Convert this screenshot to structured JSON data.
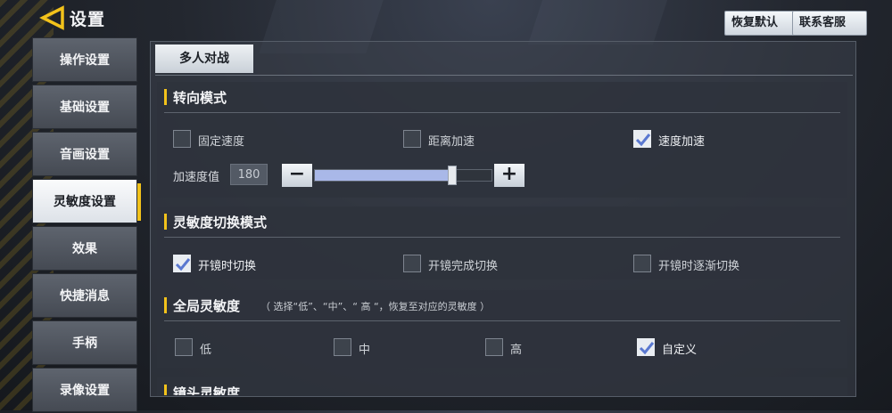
{
  "header": {
    "title": "设置",
    "restore_default": "恢复默认",
    "contact_support": "联系客服"
  },
  "sidebar": {
    "items": [
      {
        "label": "操作设置"
      },
      {
        "label": "基础设置"
      },
      {
        "label": "音画设置"
      },
      {
        "label": "灵敏度设置",
        "active": true
      },
      {
        "label": "效果"
      },
      {
        "label": "快捷消息"
      },
      {
        "label": "手柄"
      },
      {
        "label": "录像设置"
      }
    ]
  },
  "tabs": [
    {
      "label": "多人对战",
      "active": true
    }
  ],
  "turn_mode": {
    "title": "转向模式",
    "options": [
      {
        "label": "固定速度",
        "checked": false
      },
      {
        "label": "距离加速",
        "checked": false
      },
      {
        "label": "速度加速",
        "checked": true
      }
    ],
    "accel_label": "加速度值",
    "accel_value": "180",
    "accel_fraction": 0.78,
    "minus": "−",
    "plus": "+"
  },
  "switch_mode": {
    "title": "灵敏度切换模式",
    "options": [
      {
        "label": "开镜时切换",
        "checked": true
      },
      {
        "label": "开镜完成切换",
        "checked": false
      },
      {
        "label": "开镜时逐渐切换",
        "checked": false
      }
    ]
  },
  "global_sens": {
    "title": "全局灵敏度",
    "note": "（ 选择“低”、“中”、“ 高 “，恢复至对应的灵敏度 ）",
    "options": [
      {
        "label": "低",
        "checked": false
      },
      {
        "label": "中",
        "checked": false
      },
      {
        "label": "高",
        "checked": false
      },
      {
        "label": "自定义",
        "checked": true
      }
    ]
  },
  "camera_sens": {
    "title": "镜头灵敏度"
  },
  "colors": {
    "accent": "#f2c21b",
    "slider_fill": "#a9b8e8"
  }
}
